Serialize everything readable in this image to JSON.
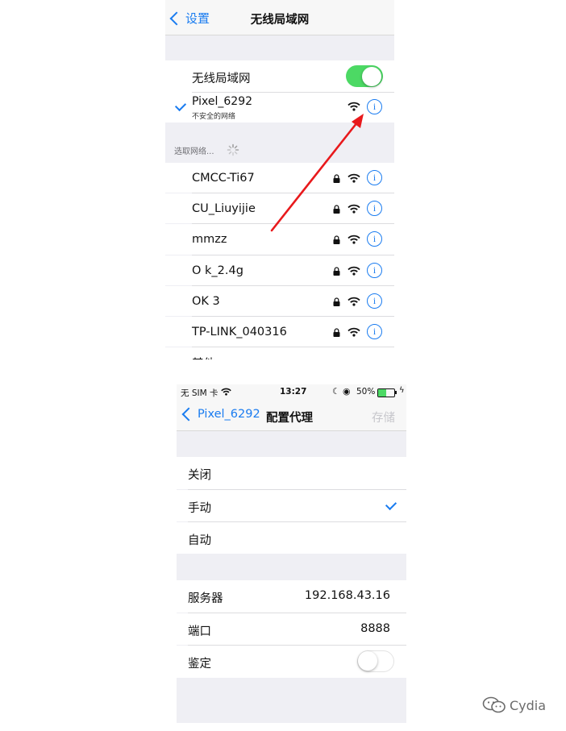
{
  "wifi_screen": {
    "nav": {
      "back_label": "设置",
      "title": "无线局域网"
    },
    "wlan_label": "无线局域网",
    "wlan_enabled": true,
    "connected": {
      "name": "Pixel_6292",
      "subtitle": "不安全的网络",
      "selected": true
    },
    "section_header": "选取网络...",
    "networks": [
      {
        "name": "CMCC-Ti67",
        "locked": true
      },
      {
        "name": "CU_Liuyijie",
        "locked": true
      },
      {
        "name": "mmzz",
        "locked": true
      },
      {
        "name": "O k_2.4g",
        "locked": true
      },
      {
        "name": "OK 3",
        "locked": true
      },
      {
        "name": "TP-LINK_040316",
        "locked": true
      }
    ],
    "other_label": "其他",
    "annotation_color": "#e8191c"
  },
  "proxy_screen": {
    "status": {
      "carrier": "无 SIM 卡",
      "time": "13:27",
      "battery": "50%"
    },
    "nav": {
      "back_label": "Pixel_6292",
      "title": "配置代理",
      "save_label": "存储"
    },
    "modes": [
      {
        "label": "关闭",
        "selected": false
      },
      {
        "label": "手动",
        "selected": true
      },
      {
        "label": "自动",
        "selected": false
      }
    ],
    "server": {
      "label": "服务器",
      "value": "192.168.43.16"
    },
    "port": {
      "label": "端口",
      "value": "8888"
    },
    "auth": {
      "label": "鉴定",
      "enabled": false
    }
  },
  "watermark": "Cydia",
  "colors": {
    "accent": "#1a7cf0",
    "toggle_on": "#4cd964",
    "group_bg": "#efeff4"
  }
}
